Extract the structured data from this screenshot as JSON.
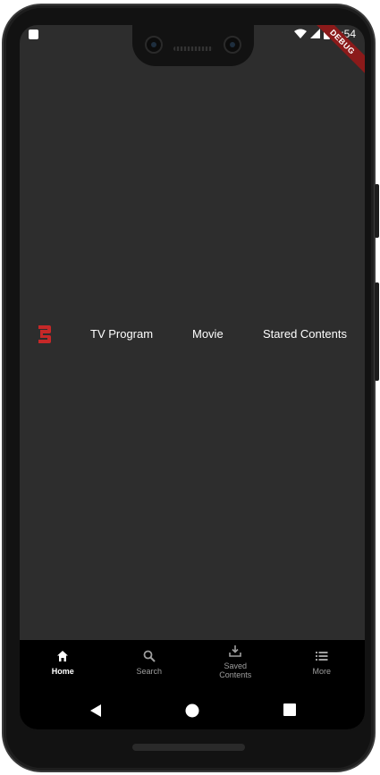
{
  "status_bar": {
    "time": "1:54",
    "debug_label": "DEBUG"
  },
  "top_nav": {
    "logo_icon": "brand-logo-icon",
    "logo_color": "#c62828",
    "links": [
      {
        "label": "TV Program"
      },
      {
        "label": "Movie"
      },
      {
        "label": "Stared Contents"
      }
    ]
  },
  "bottom_nav": {
    "items": [
      {
        "label": "Home",
        "icon": "home-icon",
        "active": true
      },
      {
        "label": "Search",
        "icon": "search-icon",
        "active": false
      },
      {
        "label": "Saved\nContents",
        "icon": "download-icon",
        "active": false
      },
      {
        "label": "More",
        "icon": "list-icon",
        "active": false
      }
    ]
  },
  "colors": {
    "screen_bg": "#2d2d2d",
    "nav_bg": "#000000",
    "active": "#ffffff",
    "inactive": "#9e9e9e",
    "debug_banner": "#8b1a1a"
  }
}
